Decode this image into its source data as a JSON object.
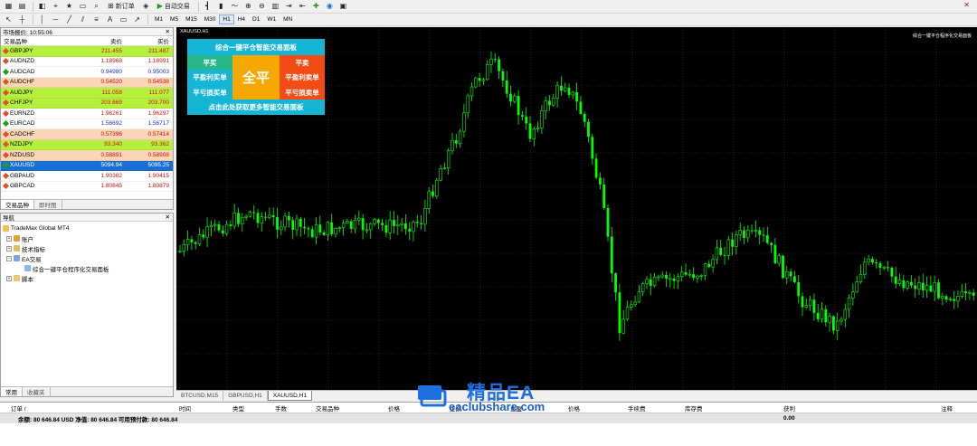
{
  "toolbar": {
    "new_order": "新订单",
    "auto_trading": "自动交易",
    "timeframes": [
      "M1",
      "M5",
      "M15",
      "M30",
      "H1",
      "H4",
      "D1",
      "W1",
      "MN"
    ],
    "active_timeframe": "H1"
  },
  "market_watch": {
    "title": "市场报价: 10:55:06",
    "col_symbol": "交易品种",
    "col_bid": "卖价",
    "col_ask": "买价",
    "rows": [
      {
        "symbol": "GBPJPY",
        "bid": "211.455",
        "ask": "211.487",
        "bg": "#b4f03c",
        "dir": "dn"
      },
      {
        "symbol": "AUDNZD",
        "bid": "1.18968",
        "ask": "1.18991",
        "bg": "#ffffff",
        "dir": "dn"
      },
      {
        "symbol": "AUDCAD",
        "bid": "0.94980",
        "ask": "0.95003",
        "bg": "#ffffff",
        "dir": "up"
      },
      {
        "symbol": "AUDCHF",
        "bid": "0.54520",
        "ask": "0.54538",
        "bg": "#fbd6b4",
        "dir": "dn"
      },
      {
        "symbol": "AUDJPY",
        "bid": "111.058",
        "ask": "111.077",
        "bg": "#b4f03c",
        "dir": "dn"
      },
      {
        "symbol": "CHFJPY",
        "bid": "203.669",
        "ask": "203.700",
        "bg": "#b4f03c",
        "dir": "dn"
      },
      {
        "symbol": "EURNZD",
        "bid": "1.96261",
        "ask": "1.96297",
        "bg": "#ffffff",
        "dir": "dn"
      },
      {
        "symbol": "EURCAD",
        "bid": "1.56692",
        "ask": "1.56717",
        "bg": "#ffffff",
        "dir": "up"
      },
      {
        "symbol": "CADCHF",
        "bid": "0.57396",
        "ask": "0.57414",
        "bg": "#fbd6b4",
        "dir": "dn"
      },
      {
        "symbol": "NZDJPY",
        "bid": "93.340",
        "ask": "93.362",
        "bg": "#b4f03c",
        "dir": "dn"
      },
      {
        "symbol": "NZDUSD",
        "bid": "0.58891",
        "ask": "0.58908",
        "bg": "#fbd6b4",
        "dir": "dn"
      },
      {
        "symbol": "XAUUSD",
        "bid": "5094.94",
        "ask": "5095.25",
        "bg": "#1a6fd2",
        "dir": "up",
        "selected": true
      },
      {
        "symbol": "GBPAUD",
        "bid": "1.90382",
        "ask": "1.90415",
        "bg": "#ffffff",
        "dir": "dn"
      },
      {
        "symbol": "GBPCAD",
        "bid": "1.80845",
        "ask": "1.80879",
        "bg": "#ffffff",
        "dir": "dn"
      }
    ],
    "tabs": [
      "交易品种",
      "即时图"
    ]
  },
  "navigator": {
    "title": "导航",
    "root": "TradeMax Global MT4",
    "items": [
      "账户",
      "技术指标",
      "EA交易",
      "综合一键平仓程序化交易面板",
      "脚本"
    ],
    "tabs": [
      "常用",
      "收藏夹"
    ]
  },
  "chart": {
    "title": "XAUUSD,H1",
    "ea_label": "综合一键平仓程序化交易面板",
    "tabs": [
      "BTCUSD,M15",
      "GBPUSD,H1",
      "XAUUSD,H1"
    ],
    "active_tab": "XAUUSD,H1"
  },
  "ea_panel": {
    "header": "综合一键平仓智能交易面板",
    "close_buys": "平买",
    "close_sells": "平卖",
    "close_all": "全平",
    "close_profit_buys": "平盈利买单",
    "close_profit_sells": "平盈利卖单",
    "close_loss_buys": "平亏损买单",
    "close_loss_sells": "平亏损卖单",
    "footer": "点击此处获取更多智能交易面板"
  },
  "terminal": {
    "headers": [
      "订单 /",
      "时间",
      "类型",
      "手数",
      "交易品种",
      "价格",
      "止损",
      "止盈",
      "价格",
      "手续费",
      "库存费",
      "获利",
      "注释"
    ],
    "balance_line": "余额: 80 646.84 USD  净值: 80 646.84  可用预付款: 80 646.84",
    "profit": "0.00"
  },
  "watermark": {
    "title": "精品EA",
    "url": "eaclubshare.com"
  }
}
